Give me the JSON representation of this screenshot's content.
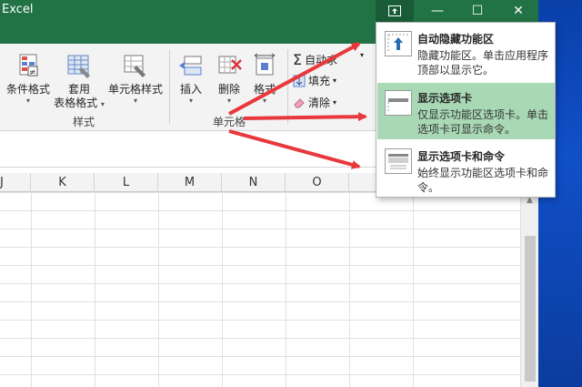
{
  "window": {
    "title": "Excel",
    "btn_ribbon_glyph": "⬆",
    "btn_min_glyph": "—",
    "btn_max_glyph": "☐",
    "btn_close_glyph": "✕"
  },
  "ribbon": {
    "styles_group": {
      "label": "样式",
      "conditional_format": "条件格式",
      "table_format_line1": "套用",
      "table_format_line2": "表格格式",
      "cell_styles": "单元格样式"
    },
    "cells_group": {
      "label": "单元格",
      "insert": "插入",
      "delete": "删除",
      "format": "格式"
    },
    "editing_group": {
      "autosum_label": "自动求",
      "fill_label": "填充",
      "clear_label": "清除",
      "autosum_glyph": "Σ",
      "caret": "▾"
    }
  },
  "columns": [
    "J",
    "K",
    "L",
    "M",
    "N",
    "O"
  ],
  "popup": {
    "items": [
      {
        "title": "自动隐藏功能区",
        "desc": "隐藏功能区。单击应用程序顶部以显示它。"
      },
      {
        "title": "显示选项卡",
        "desc": "仅显示功能区选项卡。单击选项卡可显示命令。"
      },
      {
        "title": "显示选项卡和命令",
        "desc": "始终显示功能区选项卡和命令。"
      }
    ]
  },
  "colors": {
    "titlebar": "#217346",
    "highlight": "#a9d8b5",
    "arrow": "#e8383b"
  }
}
